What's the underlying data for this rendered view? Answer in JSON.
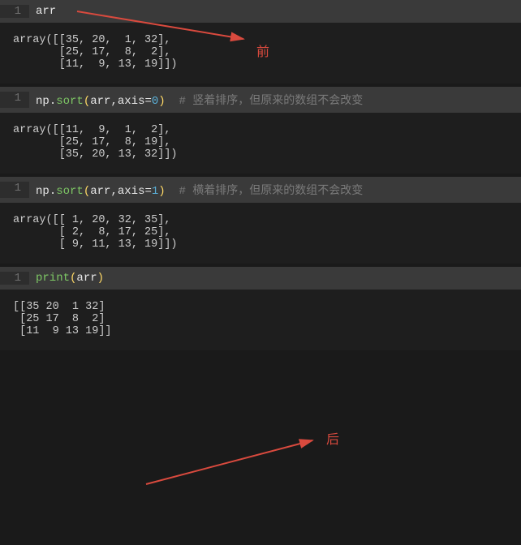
{
  "cells": [
    {
      "lineno": "1",
      "code_plain": "arr",
      "tokens": [
        [
          "var",
          "arr"
        ]
      ],
      "output": "array([[35, 20,  1, 32],\n       [25, 17,  8,  2],\n       [11,  9, 13, 19]])"
    },
    {
      "lineno": "1",
      "code_plain": "np.sort(arr,axis=0)  # 竖着排序，但原来的数组不会改变",
      "tokens": [
        [
          "var",
          "np"
        ],
        [
          "op",
          "."
        ],
        [
          "func",
          "sort"
        ],
        [
          "paren",
          "("
        ],
        [
          "var",
          "arr"
        ],
        [
          "op",
          ","
        ],
        [
          "var",
          "axis"
        ],
        [
          "op",
          "="
        ],
        [
          "num",
          "0"
        ],
        [
          "paren",
          ")"
        ],
        [
          "plain",
          "  "
        ],
        [
          "comment",
          "# 竖着排序，但原来的数组不会改变"
        ]
      ],
      "output": "array([[11,  9,  1,  2],\n       [25, 17,  8, 19],\n       [35, 20, 13, 32]])"
    },
    {
      "lineno": "1",
      "code_plain": "np.sort(arr,axis=1)  # 横着排序，但原来的数组不会改变",
      "tokens": [
        [
          "var",
          "np"
        ],
        [
          "op",
          "."
        ],
        [
          "func",
          "sort"
        ],
        [
          "paren",
          "("
        ],
        [
          "var",
          "arr"
        ],
        [
          "op",
          ","
        ],
        [
          "var",
          "axis"
        ],
        [
          "op",
          "="
        ],
        [
          "num",
          "1"
        ],
        [
          "paren",
          ")"
        ],
        [
          "plain",
          "  "
        ],
        [
          "comment",
          "# 横着排序，但原来的数组不会改变"
        ]
      ],
      "output": "array([[ 1, 20, 32, 35],\n       [ 2,  8, 17, 25],\n       [ 9, 11, 13, 19]])"
    },
    {
      "lineno": "1",
      "code_plain": "print(arr)",
      "tokens": [
        [
          "func",
          "print"
        ],
        [
          "paren",
          "("
        ],
        [
          "var",
          "arr"
        ],
        [
          "paren",
          ")"
        ]
      ],
      "output": "[[35 20  1 32]\n [25 17  8  2]\n [11  9 13 19]]"
    }
  ],
  "annotations": {
    "before": "前",
    "after": "后"
  }
}
